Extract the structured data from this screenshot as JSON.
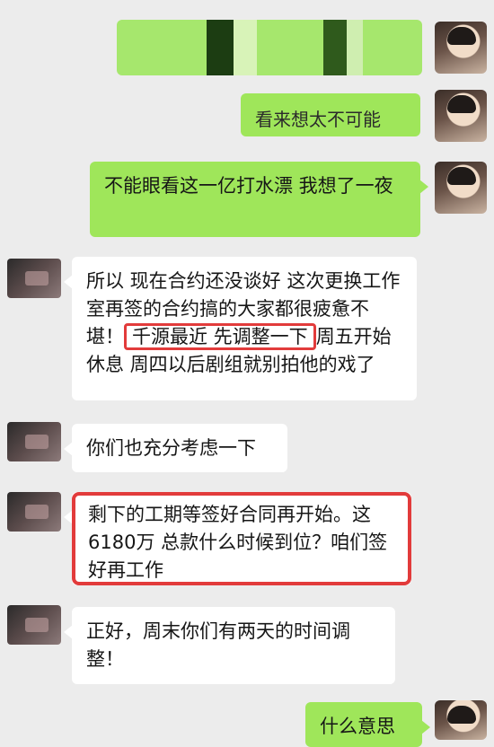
{
  "messages": [
    {
      "side": "me",
      "text": ""
    },
    {
      "side": "me",
      "text": "看来想太不可能"
    },
    {
      "side": "me",
      "text": "不能眼看这一亿打水漂 我想了一夜"
    },
    {
      "side": "other",
      "before_highlight": "所以 现在合约还没谈好 这次更换工作室再签的合约搞的大家都很疲惫不堪！",
      "highlight": "千源最近 先调整一下",
      "after_highlight": "周五开始休息 周四以后剧组就别拍他的戏了"
    },
    {
      "side": "other",
      "text": "你们也充分考虑一下"
    },
    {
      "side": "other",
      "text": "剩下的工期等签好合同再开始。这6180万 总款什么时候到位？咱们签好再工作"
    },
    {
      "side": "other",
      "text": "正好，周末你们有两天的时间调整！"
    },
    {
      "side": "me",
      "text": "什么意思"
    }
  ],
  "colors": {
    "sent": "#9fe65a",
    "received": "#ffffff",
    "highlight": "#e23b3b",
    "background": "#ececec"
  }
}
